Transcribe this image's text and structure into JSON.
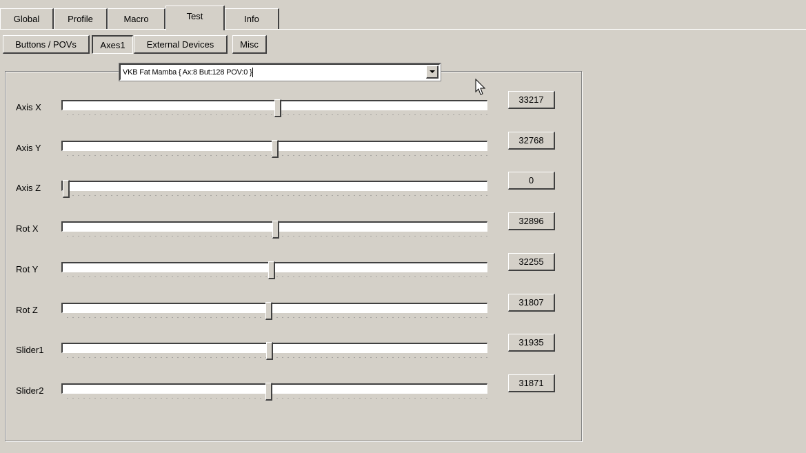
{
  "tabs": [
    {
      "label": "Global",
      "active": false
    },
    {
      "label": "Profile",
      "active": false
    },
    {
      "label": "Macro",
      "active": false
    },
    {
      "label": "Test",
      "active": true
    },
    {
      "label": "Info",
      "active": false
    }
  ],
  "subtabs": [
    {
      "label": "Buttons / POVs",
      "pressed": false
    },
    {
      "label": "Axes1",
      "pressed": true
    },
    {
      "label": "External Devices",
      "pressed": false
    },
    {
      "label": "Misc",
      "pressed": false
    }
  ],
  "device_select": {
    "value": "VKB Fat Mamba  { Ax:8 But:128 POV:0 }"
  },
  "axes": [
    {
      "label": "Axis X",
      "value": "33217",
      "position": 33217,
      "max": 65535
    },
    {
      "label": "Axis Y",
      "value": "32768",
      "position": 32768,
      "max": 65535
    },
    {
      "label": "Axis Z",
      "value": "0",
      "position": 0,
      "max": 65535
    },
    {
      "label": "Rot X",
      "value": "32896",
      "position": 32896,
      "max": 65535
    },
    {
      "label": "Rot Y",
      "value": "32255",
      "position": 32255,
      "max": 65535
    },
    {
      "label": "Rot Z",
      "value": "31807",
      "position": 31807,
      "max": 65535
    },
    {
      "label": "Slider1",
      "value": "31935",
      "position": 31935,
      "max": 65535
    },
    {
      "label": "Slider2",
      "value": "31871",
      "position": 31871,
      "max": 65535
    }
  ],
  "icons": {
    "mouse_cursor": "mouse-pointer-icon",
    "dropdown_arrow": "chevron-down-icon"
  }
}
